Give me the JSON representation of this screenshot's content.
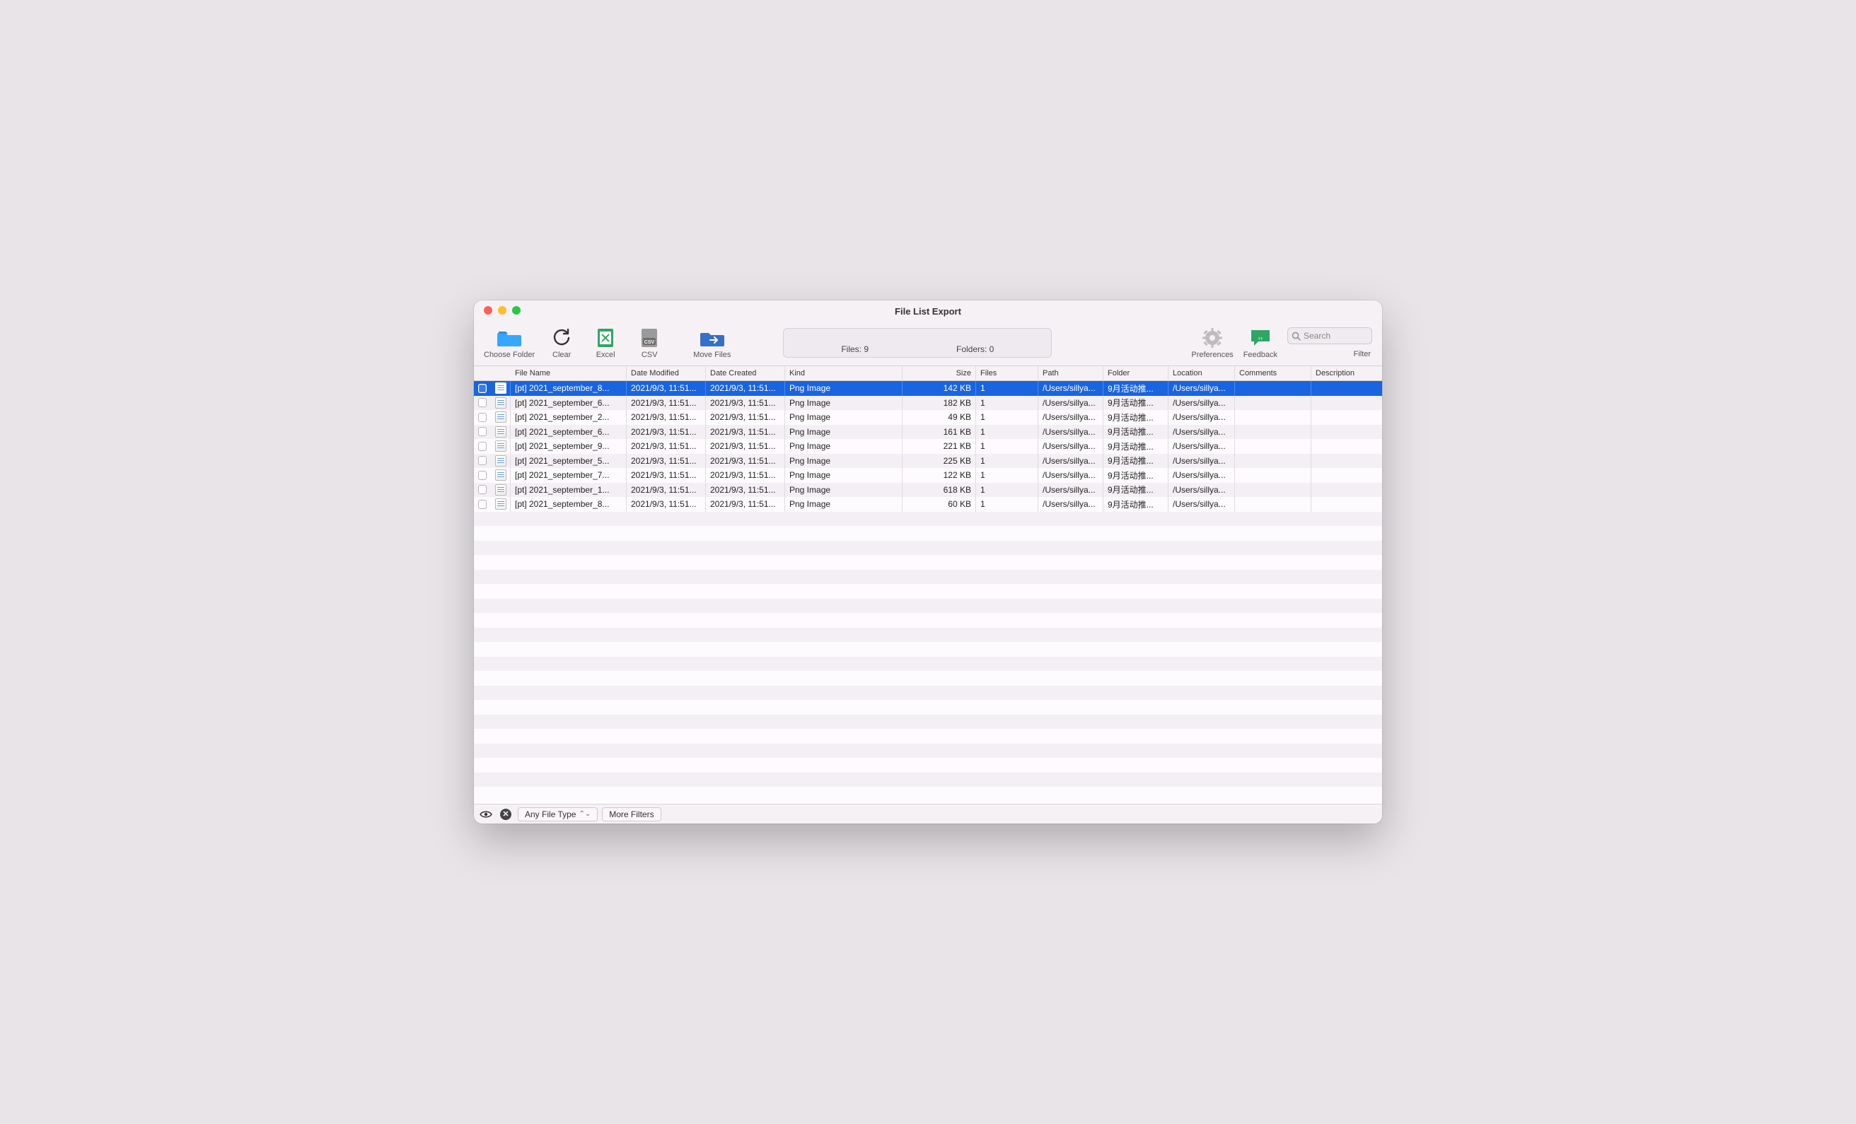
{
  "window": {
    "title": "File List Export"
  },
  "toolbar": {
    "choose_folder": "Choose Folder",
    "clear": "Clear",
    "excel": "Excel",
    "csv": "CSV",
    "move_files": "Move Files",
    "preferences": "Preferences",
    "feedback": "Feedback",
    "filter": "Filter",
    "search_placeholder": "Search"
  },
  "status": {
    "files_label": "Files: 9",
    "folders_label": "Folders: 0"
  },
  "columns": {
    "file_name": "File Name",
    "date_modified": "Date Modified",
    "date_created": "Date Created",
    "kind": "Kind",
    "size": "Size",
    "files": "Files",
    "path": "Path",
    "folder": "Folder",
    "location": "Location",
    "comments": "Comments",
    "description": "Description"
  },
  "rows": [
    {
      "selected": true,
      "name": "[pt] 2021_september_8...",
      "modified": "2021/9/3, 11:51...",
      "created": "2021/9/3, 11:51...",
      "kind": "Png Image",
      "size": "142 KB",
      "files": "1",
      "path": "/Users/sillya...",
      "folder": "9月活动推...",
      "location": "/Users/sillya...",
      "comments": "",
      "description": ""
    },
    {
      "selected": false,
      "name": "[pt] 2021_september_6...",
      "modified": "2021/9/3, 11:51...",
      "created": "2021/9/3, 11:51...",
      "kind": "Png Image",
      "size": "182 KB",
      "files": "1",
      "path": "/Users/sillya...",
      "folder": "9月活动推...",
      "location": "/Users/sillya...",
      "comments": "",
      "description": ""
    },
    {
      "selected": false,
      "name": "[pt] 2021_september_2...",
      "modified": "2021/9/3, 11:51...",
      "created": "2021/9/3, 11:51...",
      "kind": "Png Image",
      "size": "49 KB",
      "files": "1",
      "path": "/Users/sillya...",
      "folder": "9月活动推...",
      "location": "/Users/sillya...",
      "comments": "",
      "description": ""
    },
    {
      "selected": false,
      "name": "[pt] 2021_september_6...",
      "modified": "2021/9/3, 11:51...",
      "created": "2021/9/3, 11:51...",
      "kind": "Png Image",
      "size": "161 KB",
      "files": "1",
      "path": "/Users/sillya...",
      "folder": "9月活动推...",
      "location": "/Users/sillya...",
      "comments": "",
      "description": ""
    },
    {
      "selected": false,
      "name": "[pt] 2021_september_9...",
      "modified": "2021/9/3, 11:51...",
      "created": "2021/9/3, 11:51...",
      "kind": "Png Image",
      "size": "221 KB",
      "files": "1",
      "path": "/Users/sillya...",
      "folder": "9月活动推...",
      "location": "/Users/sillya...",
      "comments": "",
      "description": ""
    },
    {
      "selected": false,
      "name": "[pt] 2021_september_5...",
      "modified": "2021/9/3, 11:51...",
      "created": "2021/9/3, 11:51...",
      "kind": "Png Image",
      "size": "225 KB",
      "files": "1",
      "path": "/Users/sillya...",
      "folder": "9月活动推...",
      "location": "/Users/sillya...",
      "comments": "",
      "description": ""
    },
    {
      "selected": false,
      "name": "[pt] 2021_september_7...",
      "modified": "2021/9/3, 11:51...",
      "created": "2021/9/3, 11:51...",
      "kind": "Png Image",
      "size": "122 KB",
      "files": "1",
      "path": "/Users/sillya...",
      "folder": "9月活动推...",
      "location": "/Users/sillya...",
      "comments": "",
      "description": ""
    },
    {
      "selected": false,
      "name": "[pt] 2021_september_1...",
      "modified": "2021/9/3, 11:51...",
      "created": "2021/9/3, 11:51...",
      "kind": "Png Image",
      "size": "618 KB",
      "files": "1",
      "path": "/Users/sillya...",
      "folder": "9月活动推...",
      "location": "/Users/sillya...",
      "comments": "",
      "description": ""
    },
    {
      "selected": false,
      "name": "[pt] 2021_september_8...",
      "modified": "2021/9/3, 11:51...",
      "created": "2021/9/3, 11:51...",
      "kind": "Png Image",
      "size": "60 KB",
      "files": "1",
      "path": "/Users/sillya...",
      "folder": "9月活动推...",
      "location": "/Users/sillya...",
      "comments": "",
      "description": ""
    }
  ],
  "bottom": {
    "any_file_type": "Any File Type",
    "more_filters": "More Filters"
  },
  "empty_rows": 20
}
